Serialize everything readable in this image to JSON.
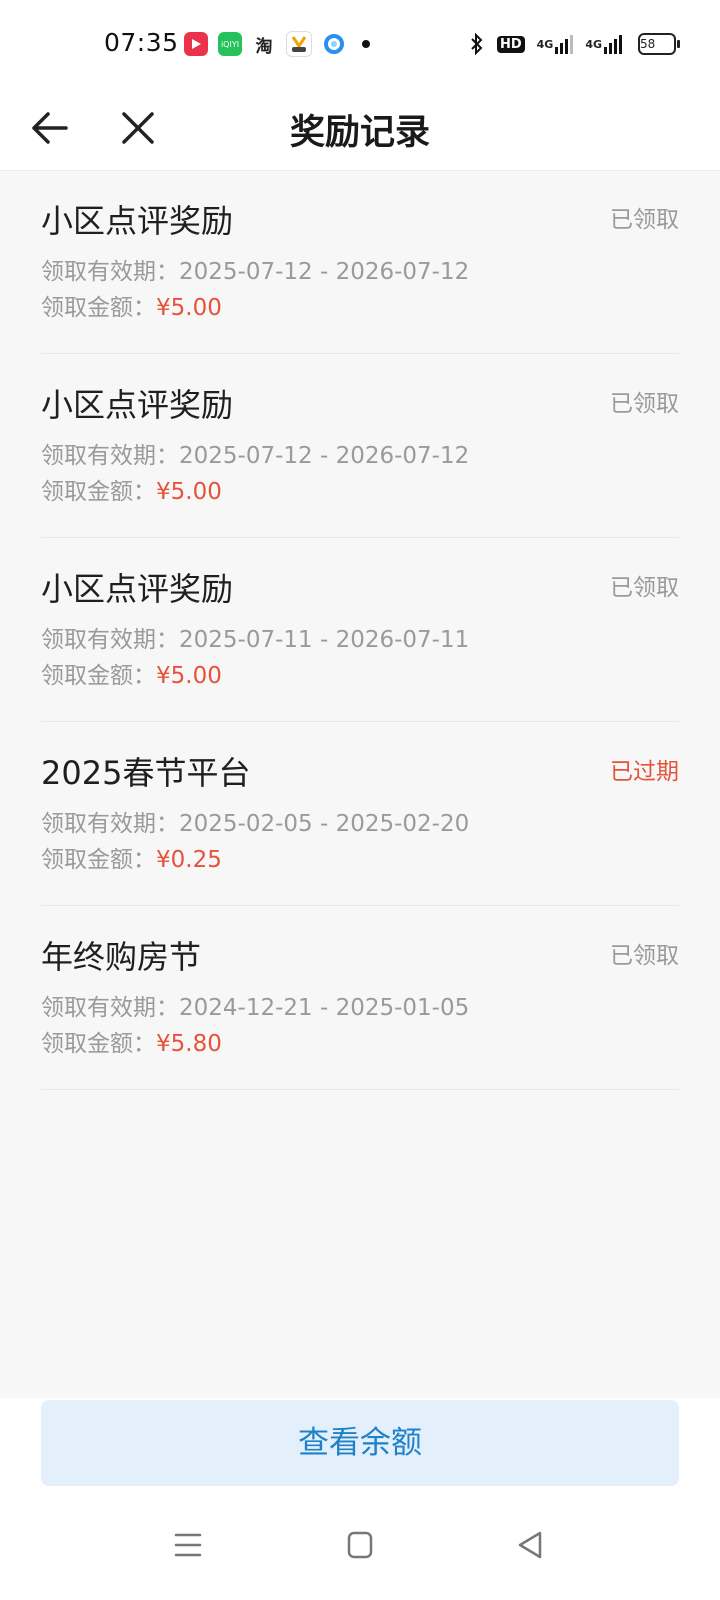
{
  "status_bar": {
    "time": "07:35",
    "apps": [
      "video-app-icon",
      "iqiyi-app-icon",
      "taobao-app-icon",
      "coin-app-icon",
      "qq-browser-icon"
    ],
    "app_labels": {
      "iqiyi": "iQIYI",
      "taobao": "淘"
    },
    "hd": "HD",
    "network_1": "4G",
    "network_2": "4G",
    "battery": "58"
  },
  "header": {
    "title": "奖励记录"
  },
  "labels": {
    "period_label": "领取有效期：",
    "amount_label": "领取金额："
  },
  "rewards": [
    {
      "title": "小区点评奖励",
      "status": "已领取",
      "period": "2025-07-12 - 2026-07-12",
      "amount": "¥5.00"
    },
    {
      "title": "小区点评奖励",
      "status": "已领取",
      "period": "2025-07-12 - 2026-07-12",
      "amount": "¥5.00"
    },
    {
      "title": "小区点评奖励",
      "status": "已领取",
      "period": "2025-07-11 - 2026-07-11",
      "amount": "¥5.00"
    },
    {
      "title": "2025春节平台",
      "status": "已过期",
      "period": "2025-02-05 - 2025-02-20",
      "amount": "¥0.25"
    },
    {
      "title": "年终购房节",
      "status": "已领取",
      "period": "2024-12-21 - 2025-01-05",
      "amount": "¥5.80"
    }
  ],
  "bottom": {
    "balance_button": "查看余额"
  },
  "colors": {
    "accent_red": "#e5533d",
    "button_bg": "#e3f0fb",
    "button_text": "#1f82c8"
  }
}
